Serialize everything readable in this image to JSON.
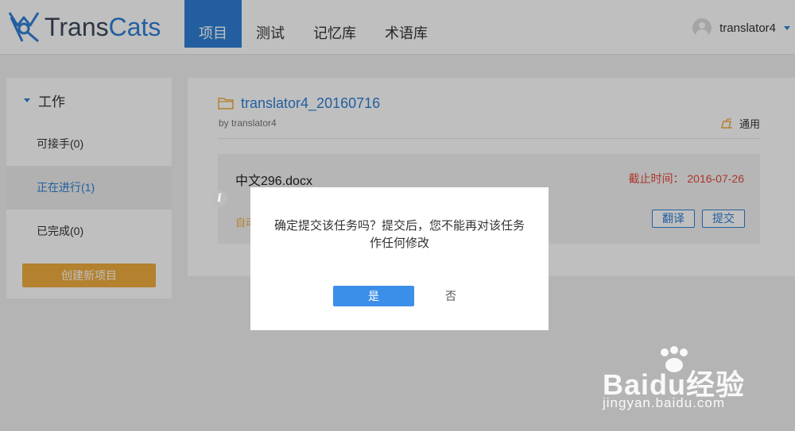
{
  "app": {
    "logo_text_1": "Trans",
    "logo_text_2": "Cats",
    "brand_color": "#2f7fd6"
  },
  "nav": {
    "items": [
      {
        "label": "项目",
        "active": true
      },
      {
        "label": "测试",
        "active": false
      },
      {
        "label": "记忆库",
        "active": false
      },
      {
        "label": "术语库",
        "active": false
      }
    ]
  },
  "user": {
    "name": "translator4",
    "icon": "avatar-icon"
  },
  "sidebar": {
    "heading": "工作",
    "items": [
      {
        "label": "可接手(0)",
        "active": false
      },
      {
        "label": "正在进行(1)",
        "active": true
      },
      {
        "label": "已完成(0)",
        "active": false
      }
    ],
    "create_label": "创建新项目",
    "create_color": "#f0ad3e"
  },
  "project": {
    "title": "translator4_20160716",
    "by": "by translator4",
    "type_label": "通用"
  },
  "task": {
    "file_name": "中文296.docx",
    "deadline": "截止时间： 2016-07-26",
    "auto_text": "自动",
    "translate_label": "翻译",
    "submit_label": "提交",
    "deadline_color": "#e24a3b"
  },
  "dialog": {
    "message": "确定提交该任务吗？提交后，您不能再对该任务作任何修改",
    "yes_label": "是",
    "no_label": "否"
  },
  "watermark": {
    "brand": "Baidu经验",
    "url": "jingyan.baidu.com"
  }
}
